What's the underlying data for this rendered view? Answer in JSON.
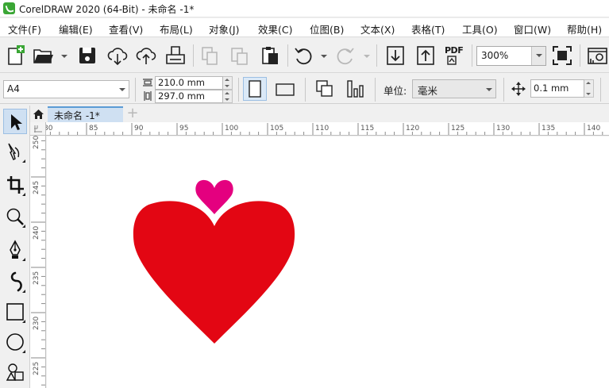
{
  "window": {
    "title": "CorelDRAW 2020 (64-Bit) - 未命名 -1*",
    "logo_icon": "coreldraw-logo-icon"
  },
  "menu": [
    {
      "id": "file",
      "label": "文件(F)"
    },
    {
      "id": "edit",
      "label": "编辑(E)"
    },
    {
      "id": "view",
      "label": "查看(V)"
    },
    {
      "id": "layout",
      "label": "布局(L)"
    },
    {
      "id": "object",
      "label": "对象(J)"
    },
    {
      "id": "effects",
      "label": "效果(C)"
    },
    {
      "id": "bitmaps",
      "label": "位图(B)"
    },
    {
      "id": "text",
      "label": "文本(X)"
    },
    {
      "id": "table",
      "label": "表格(T)"
    },
    {
      "id": "tools",
      "label": "工具(O)"
    },
    {
      "id": "window",
      "label": "窗口(W)"
    },
    {
      "id": "help",
      "label": "帮助(H)"
    }
  ],
  "toolbar": {
    "icons": [
      "new-document-icon",
      "open-folder-icon",
      "save-icon",
      "cloud-download-icon",
      "cloud-upload-icon",
      "print-icon",
      "copy-icon",
      "paste-icon",
      "clipboard-icon",
      "undo-icon",
      "redo-icon",
      "import-icon",
      "export-icon",
      "publish-pdf-icon",
      "full-screen-icon",
      "options-icon"
    ],
    "pdf_label": "PDF",
    "zoom_level": "300%"
  },
  "property_bar": {
    "page_size": "A4",
    "page_width": "210.0 mm",
    "page_height": "297.0 mm",
    "units_label": "单位:",
    "units_value": "毫米",
    "nudge_distance": "0.1 mm",
    "orientation": "portrait"
  },
  "tabs": {
    "home_icon": "home-icon",
    "document_tab": "未命名 -1*",
    "add_tab": "+"
  },
  "rulers": {
    "horizontal_ticks": [
      "80",
      "85",
      "90",
      "95",
      "100",
      "105",
      "110",
      "115",
      "120",
      "125",
      "130",
      "135",
      "140"
    ],
    "vertical_ticks": [
      "250",
      "245",
      "240",
      "235",
      "230",
      "225"
    ],
    "unit": "毫米"
  },
  "canvas": {
    "shapes": [
      {
        "type": "heart",
        "name": "large heart",
        "color": "#e30613"
      },
      {
        "type": "heart",
        "name": "small heart",
        "color": "#e4007f"
      }
    ]
  },
  "toolbox": {
    "tools": [
      "pick-tool-icon",
      "shape-tool-icon",
      "crop-tool-icon",
      "zoom-tool-icon",
      "pen-tool-icon",
      "artistic-media-tool-icon",
      "rectangle-tool-icon",
      "ellipse-tool-icon",
      "basic-shapes-tool-icon"
    ],
    "active_tool": "pick-tool-icon"
  },
  "colors": {
    "accent": "#5b9bd5",
    "heart_red": "#e30613",
    "heart_magenta": "#e4007f",
    "logo_green": "#3aa635"
  }
}
